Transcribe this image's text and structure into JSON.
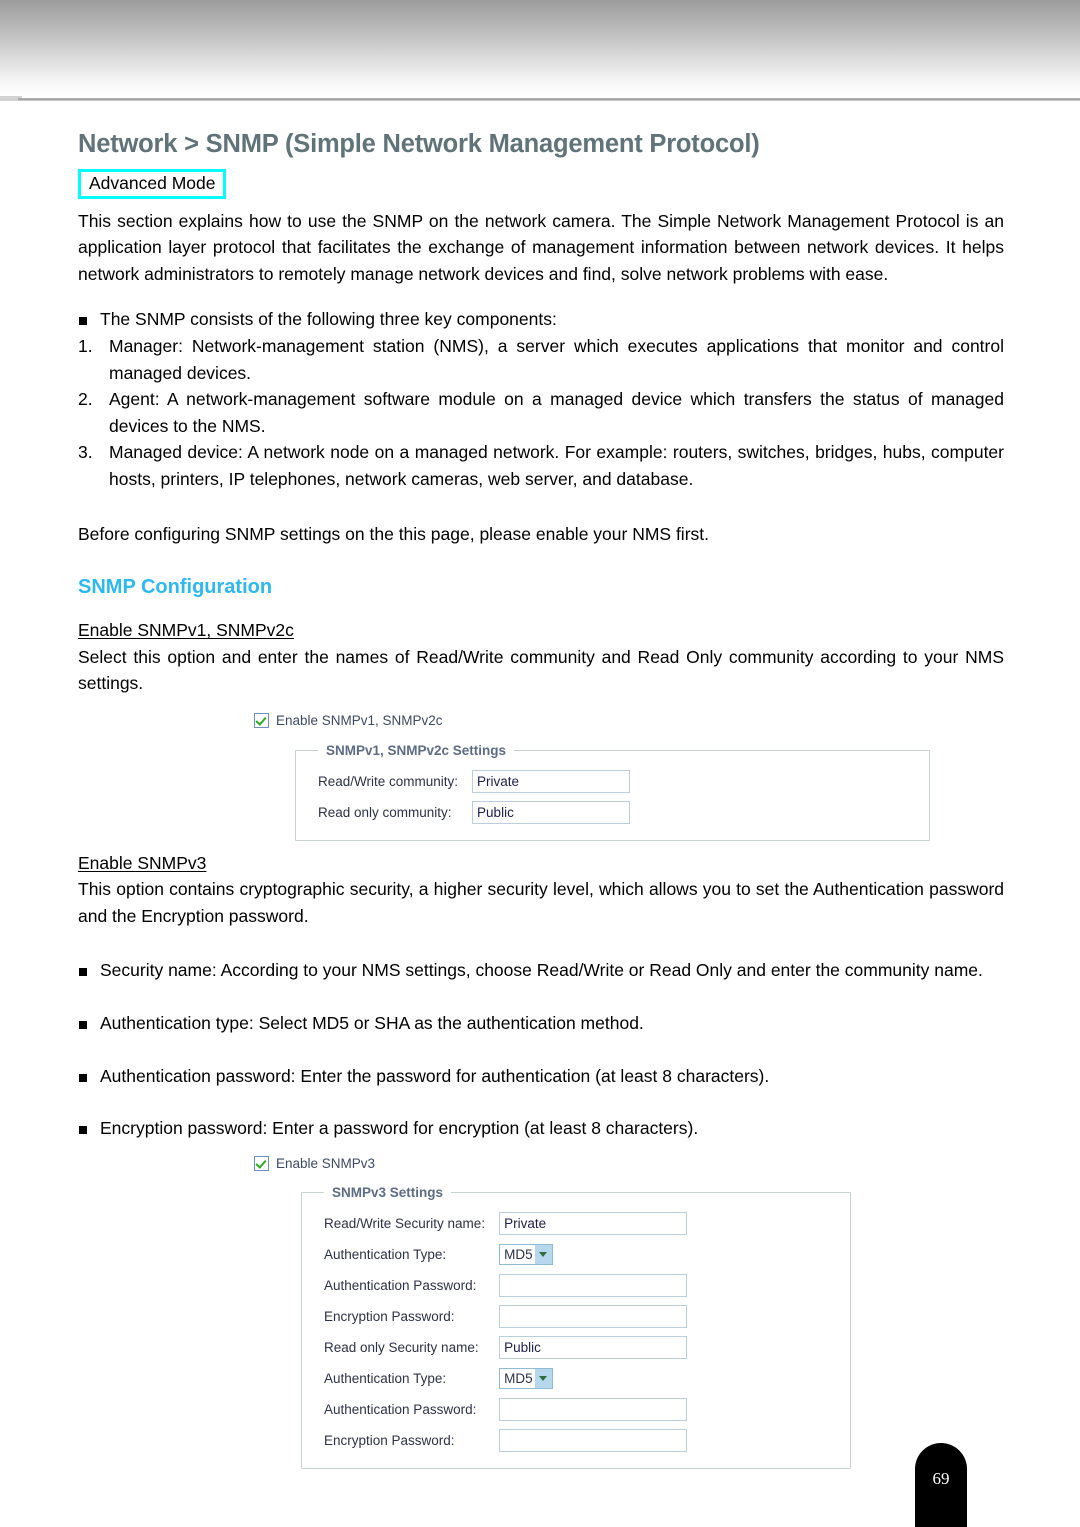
{
  "page": {
    "number": "69"
  },
  "header": {
    "title": "Network > SNMP (Simple Network Management Protocol)",
    "badge": "Advanced Mode"
  },
  "intro": {
    "paragraph": "This section explains how to use the SNMP on the network camera. The Simple Network Management Protocol is an application layer protocol that facilitates the exchange of management information between network devices. It helps network administrators to remotely manage network devices and find, solve network problems with ease."
  },
  "components": {
    "lead": "The SNMP consists of the following three key components:",
    "items": [
      "Manager: Network-management station (NMS), a server which executes applications that monitor and control managed devices.",
      "Agent: A network-management software module on a managed device which transfers the status of managed devices to the NMS.",
      "Managed device: A network node on a managed network. For example: routers, switches, bridges, hubs, computer hosts, printers, IP telephones, network cameras, web server, and database."
    ]
  },
  "note": {
    "text": "Before configuring SNMP settings on the this page, please enable your NMS first."
  },
  "config_section": {
    "heading": "SNMP Configuration"
  },
  "v1v2c": {
    "sub_head": "Enable SNMPv1, SNMPv2c",
    "description": "Select this option and enter the names of Read/Write community and Read Only community according to your NMS settings.",
    "screenshot": {
      "checkbox_label": "Enable SNMPv1, SNMPv2c",
      "legend": "SNMPv1, SNMPv2c Settings",
      "rows": [
        {
          "label": "Read/Write community:",
          "value": "Private",
          "type": "text"
        },
        {
          "label": "Read only community:",
          "value": "Public",
          "type": "text"
        }
      ]
    }
  },
  "v3": {
    "sub_head": "Enable SNMPv3",
    "description": "This option contains cryptographic security, a higher security level, which allows you to set the Authentication password and the Encryption password.",
    "bullets": [
      "Security name: According to your NMS settings, choose Read/Write or Read Only and enter the community name.",
      "Authentication type: Select MD5 or SHA as the authentication method.",
      "Authentication password: Enter the password for authentication (at least 8 characters).",
      "Encryption password: Enter a password for encryption (at least 8 characters)."
    ],
    "screenshot": {
      "checkbox_label": "Enable SNMPv3",
      "legend": "SNMPv3 Settings",
      "rows": [
        {
          "label": "Read/Write Security name:",
          "value": "Private",
          "type": "text"
        },
        {
          "label": "Authentication Type:",
          "value": "MD5",
          "type": "select"
        },
        {
          "label": "Authentication Password:",
          "value": "",
          "type": "text"
        },
        {
          "label": "Encryption Password:",
          "value": "",
          "type": "text"
        },
        {
          "label": "Read only Security name:",
          "value": "Public",
          "type": "text"
        },
        {
          "label": "Authentication Type:",
          "value": "MD5",
          "type": "select"
        },
        {
          "label": "Authentication Password:",
          "value": "",
          "type": "text"
        },
        {
          "label": "Encryption Password:",
          "value": "",
          "type": "text"
        }
      ]
    }
  },
  "colors": {
    "title": "#5f7378",
    "section_heading": "#2cb8f0",
    "badge_border": "#00ffff",
    "checkbox_check": "#2faa22",
    "fieldset_legend": "#5d6b85"
  }
}
